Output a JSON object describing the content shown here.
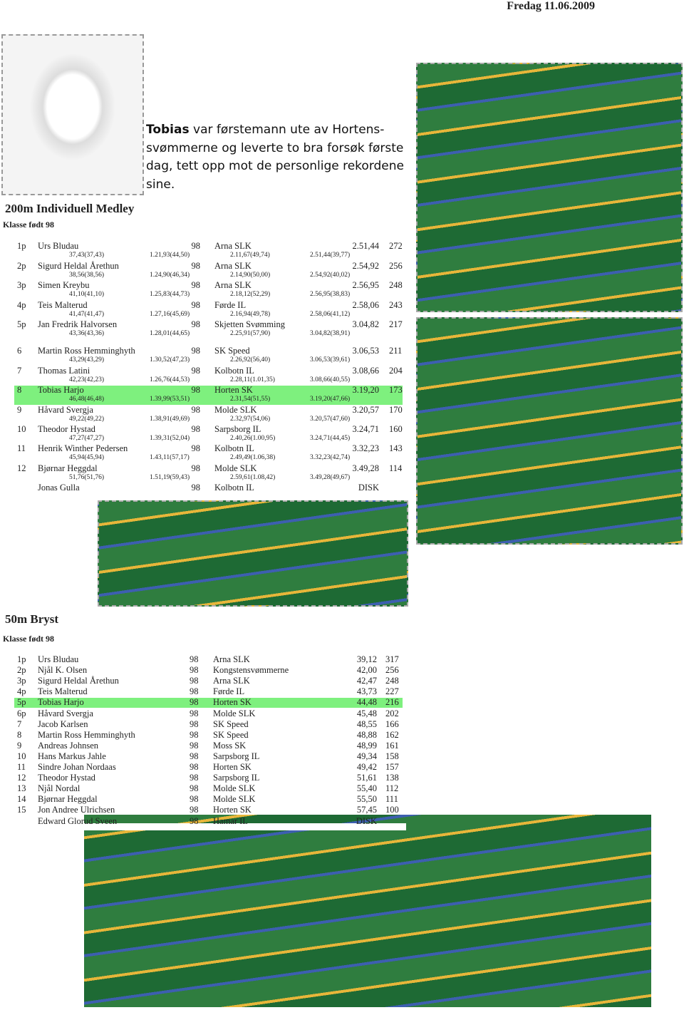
{
  "header": {
    "date": "Fredag 11.06.2009"
  },
  "caption": {
    "name": "Tobias",
    "text": " var førstemann ute av Hortens-svømmerne og leverte to bra forsøk første dag, tett opp mot de personlige rekordene sine."
  },
  "medley": {
    "title": "200m Individuell Medley",
    "class": "Klasse født 98",
    "highlight_color": "#7ef07e",
    "rows": [
      {
        "place": "1p",
        "name": "Urs Bludau",
        "year": "98",
        "club": "Arna SLK",
        "time": "2.51,44",
        "points": "272",
        "splits": [
          "37,43(37,43)",
          "1.21,93(44,50)",
          "2.11,67(49,74)",
          "2.51,44(39,77)"
        ]
      },
      {
        "place": "2p",
        "name": "Sigurd Heldal Årethun",
        "year": "98",
        "club": "Arna SLK",
        "time": "2.54,92",
        "points": "256",
        "splits": [
          "38,56(38,56)",
          "1.24,90(46,34)",
          "2.14,90(50,00)",
          "2.54,92(40,02)"
        ]
      },
      {
        "place": "3p",
        "name": "Simen Kreybu",
        "year": "98",
        "club": "Arna SLK",
        "time": "2.56,95",
        "points": "248",
        "splits": [
          "41,10(41,10)",
          "1.25,83(44,73)",
          "2.18,12(52,29)",
          "2.56,95(38,83)"
        ]
      },
      {
        "place": "4p",
        "name": "Teis Malterud",
        "year": "98",
        "club": "Førde IL",
        "time": "2.58,06",
        "points": "243",
        "splits": [
          "41,47(41,47)",
          "1.27,16(45,69)",
          "2.16,94(49,78)",
          "2.58,06(41,12)"
        ]
      },
      {
        "place": "5p",
        "name": "Jan Fredrik Halvorsen",
        "year": "98",
        "club": "Skjetten Svømming",
        "time": "3.04,82",
        "points": "217",
        "splits": [
          "43,36(43,36)",
          "1.28,01(44,65)",
          "2.25,91(57,90)",
          "3.04,82(38,91)"
        ]
      },
      {
        "place": "6",
        "name": "Martin Ross Hemminghyth",
        "year": "98",
        "club": "SK Speed",
        "time": "3.06,53",
        "points": "211",
        "splits": [
          "43,29(43,29)",
          "1.30,52(47,23)",
          "2.26,92(56,40)",
          "3.06,53(39,61)"
        ]
      },
      {
        "place": "7",
        "name": "Thomas Latini",
        "year": "98",
        "club": "Kolbotn IL",
        "time": "3.08,66",
        "points": "204",
        "splits": [
          "42,23(42,23)",
          "1.26,76(44,53)",
          "2.28,11(1.01,35)",
          "3.08,66(40,55)"
        ]
      },
      {
        "place": "8",
        "name": "Tobias Harjo",
        "year": "98",
        "club": "Horten SK",
        "time": "3.19,20",
        "points": "173",
        "highlight": true,
        "splits": [
          "46,48(46,48)",
          "1.39,99(53,51)",
          "2.31,54(51,55)",
          "3.19,20(47,66)"
        ]
      },
      {
        "place": "9",
        "name": "Håvard Svergja",
        "year": "98",
        "club": "Molde SLK",
        "time": "3.20,57",
        "points": "170",
        "splits": [
          "49,22(49,22)",
          "1.38,91(49,69)",
          "2.32,97(54,06)",
          "3.20,57(47,60)"
        ]
      },
      {
        "place": "10",
        "name": "Theodor Hystad",
        "year": "98",
        "club": "Sarpsborg IL",
        "time": "3.24,71",
        "points": "160",
        "splits": [
          "47,27(47,27)",
          "1.39,31(52,04)",
          "2.40,26(1.00,95)",
          "3.24,71(44,45)"
        ]
      },
      {
        "place": "11",
        "name": "Henrik Winther Pedersen",
        "year": "98",
        "club": "Kolbotn IL",
        "time": "3.32,23",
        "points": "143",
        "splits": [
          "45,94(45,94)",
          "1.43,11(57,17)",
          "2.49,49(1.06,38)",
          "3.32,23(42,74)"
        ]
      },
      {
        "place": "12",
        "name": "Bjørnar Heggdal",
        "year": "98",
        "club": "Molde SLK",
        "time": "3.49,28",
        "points": "114",
        "splits": [
          "51,76(51,76)",
          "1.51,19(59,43)",
          "2.59,61(1.08,42)",
          "3.49,28(49,67)"
        ]
      },
      {
        "place": "",
        "name": "Jonas Gulla",
        "year": "98",
        "club": "Kolbotn IL",
        "time": "DISK",
        "points": "",
        "splits": []
      }
    ]
  },
  "breast": {
    "title": "50m Bryst",
    "class": "Klasse født 98",
    "rows": [
      {
        "place": "1p",
        "name": "Urs Bludau",
        "year": "98",
        "club": "Arna SLK",
        "time": "39,12",
        "points": "317"
      },
      {
        "place": "2p",
        "name": "Njål K. Olsen",
        "year": "98",
        "club": "Kongstensvømmerne",
        "time": "42,00",
        "points": "256"
      },
      {
        "place": "3p",
        "name": "Sigurd Heldal Årethun",
        "year": "98",
        "club": "Arna SLK",
        "time": "42,47",
        "points": "248"
      },
      {
        "place": "4p",
        "name": "Teis Malterud",
        "year": "98",
        "club": "Førde IL",
        "time": "43,73",
        "points": "227"
      },
      {
        "place": "5p",
        "name": "Tobias Harjo",
        "year": "98",
        "club": "Horten SK",
        "time": "44,48",
        "points": "216",
        "highlight": true
      },
      {
        "place": "6p",
        "name": "Håvard Svergja",
        "year": "98",
        "club": "Molde SLK",
        "time": "45,48",
        "points": "202"
      },
      {
        "place": "7",
        "name": "Jacob Karlsen",
        "year": "98",
        "club": "SK Speed",
        "time": "48,55",
        "points": "166"
      },
      {
        "place": "8",
        "name": "Martin Ross Hemminghyth",
        "year": "98",
        "club": "SK Speed",
        "time": "48,88",
        "points": "162"
      },
      {
        "place": "9",
        "name": "Andreas Johnsen",
        "year": "98",
        "club": "Moss SK",
        "time": "48,99",
        "points": "161"
      },
      {
        "place": "10",
        "name": "Hans Markus Jahle",
        "year": "98",
        "club": "Sarpsborg IL",
        "time": "49,34",
        "points": "158"
      },
      {
        "place": "11",
        "name": "Sindre Johan Nordaas",
        "year": "98",
        "club": "Horten SK",
        "time": "49,42",
        "points": "157"
      },
      {
        "place": "12",
        "name": "Theodor Hystad",
        "year": "98",
        "club": "Sarpsborg IL",
        "time": "51,61",
        "points": "138"
      },
      {
        "place": "13",
        "name": "Njål Nordal",
        "year": "98",
        "club": "Molde SLK",
        "time": "55,40",
        "points": "112"
      },
      {
        "place": "14",
        "name": "Bjørnar Heggdal",
        "year": "98",
        "club": "Molde SLK",
        "time": "55,50",
        "points": "111"
      },
      {
        "place": "15",
        "name": "Jon Andree Ulrichsen",
        "year": "98",
        "club": "Horten SK",
        "time": "57,45",
        "points": "100"
      },
      {
        "place": "",
        "name": "Edward Glorud Sveen",
        "year": "98",
        "club": "Hamar IL",
        "time": "DISK",
        "points": ""
      }
    ]
  }
}
